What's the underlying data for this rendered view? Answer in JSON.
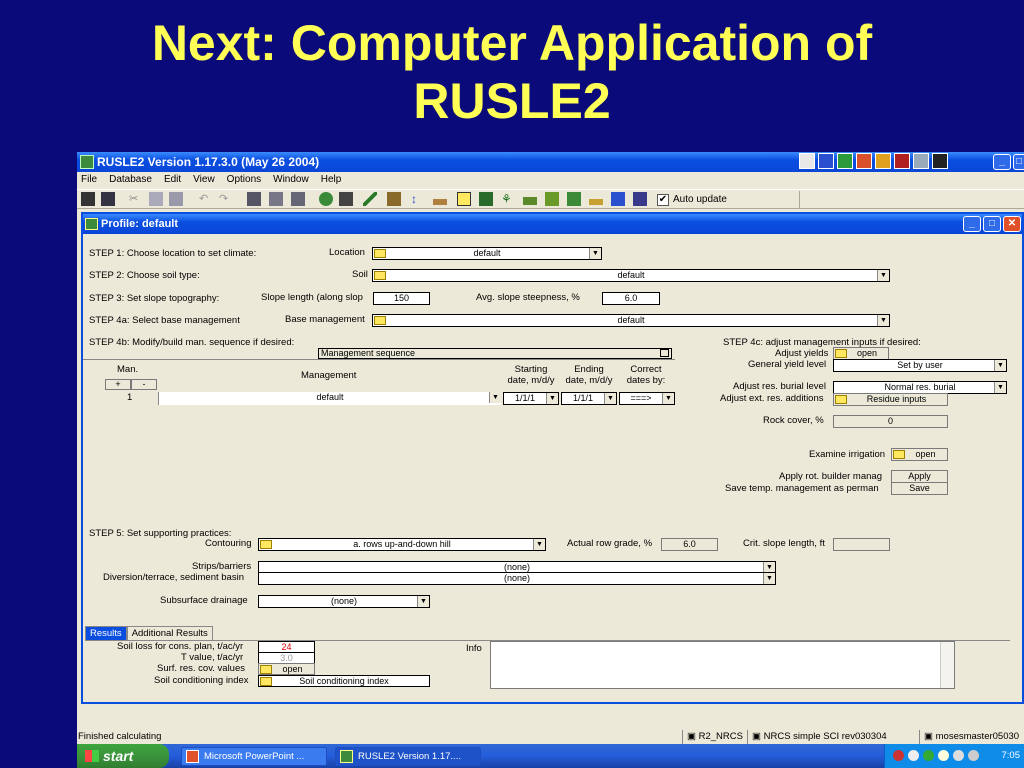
{
  "slide": {
    "title_line1": "Next: Computer Application of",
    "title_line2": "RUSLE2"
  },
  "window": {
    "title": "RUSLE2 Version 1.17.3.0 (May 26 2004)",
    "min": "_",
    "max": "□"
  },
  "menu": [
    "File",
    "Database",
    "Edit",
    "View",
    "Options",
    "Window",
    "Help"
  ],
  "toolbar": {
    "auto_update_label": "Auto update",
    "auto_update_checked": "✔"
  },
  "profile": {
    "title": "Profile:  default",
    "step1": {
      "label": "STEP 1: Choose location to set climate:",
      "field_label": "Location",
      "value": "default"
    },
    "step2": {
      "label": "STEP 2: Choose soil type:",
      "field_label": "Soil",
      "value": "default"
    },
    "step3": {
      "label": "STEP 3: Set slope topography:",
      "length_label": "Slope length (along slop",
      "length_value": "150",
      "steep_label": "Avg. slope steepness, %",
      "steep_value": "6.0"
    },
    "step4a": {
      "label": "STEP 4a: Select base management",
      "field_label": "Base management",
      "value": "default"
    },
    "step4b": {
      "label": "STEP 4b: Modify/build man. sequence if desired:"
    },
    "mgmt": {
      "header": "Management sequence",
      "col_man": "Man.",
      "col_management": "Management",
      "col_start": "Starting date, m/d/y",
      "col_end": "Ending date, m/d/y",
      "col_correct": "Correct dates by:",
      "plus": "+",
      "minus": "-",
      "row": {
        "num": "1",
        "management": "default",
        "start": "1/1/1",
        "end": "1/1/1",
        "correct": "===>"
      }
    },
    "step4c": {
      "label": "STEP 4c: adjust management inputs if desired:",
      "adjust_yields_label": "Adjust yields",
      "adjust_yields_value": "open",
      "yield_level_label": "General yield level",
      "yield_level_value": "Set by user",
      "res_burial_label": "Adjust res. burial level",
      "res_burial_value": "Normal res. burial",
      "ext_res_label": "Adjust ext. res. additions",
      "ext_res_value": "Residue inputs",
      "rock_cover_label": "Rock cover, %",
      "rock_cover_value": "0",
      "irrigation_label": "Examine irrigation",
      "irrigation_value": "open",
      "rot_builder_label": "Apply rot. builder manag",
      "rot_builder_btn": "Apply",
      "save_temp_label": "Save temp. management as perman",
      "save_temp_btn": "Save"
    },
    "step5": {
      "label": "STEP 5: Set supporting practices:",
      "contouring_label": "Contouring",
      "contouring_value": "a. rows up-and-down hill",
      "row_grade_label": "Actual row grade, %",
      "row_grade_value": "6.0",
      "crit_slope_label": "Crit. slope length, ft",
      "crit_slope_value": "",
      "strips_label": "Strips/barriers",
      "strips_value": "(none)",
      "diversion_label": "Diversion/terrace, sediment basin",
      "diversion_value": "(none)",
      "subsurface_label": "Subsurface drainage",
      "subsurface_value": "(none)"
    },
    "tabs": [
      "Results",
      "Additional Results"
    ],
    "results": {
      "soil_loss_label": "Soil loss for cons. plan, t/ac/yr",
      "soil_loss_value": "24",
      "t_value_label": "T value, t/ac/yr",
      "t_value_value": "3.0",
      "surf_res_label": "Surf. res. cov. values",
      "surf_res_value": "open",
      "sci_label": "Soil conditioning index",
      "sci_value": "Soil conditioning index",
      "info_label": "Info"
    }
  },
  "statusbar": {
    "left": "Finished calculating",
    "pane1": "R2_NRCS",
    "pane2": "NRCS simple SCI rev030304",
    "pane3": "mosesmaster05030"
  },
  "taskbar": {
    "start": "start",
    "item1": "Microsoft PowerPoint ...",
    "item2": "RUSLE2 Version 1.17....",
    "clock": "7:05"
  },
  "colors": {
    "slide_bg": "#0a0a7a",
    "title_yellow": "#ffff55",
    "xp_blue": "#0a4ee0",
    "soil_loss_red": "#e00000"
  }
}
